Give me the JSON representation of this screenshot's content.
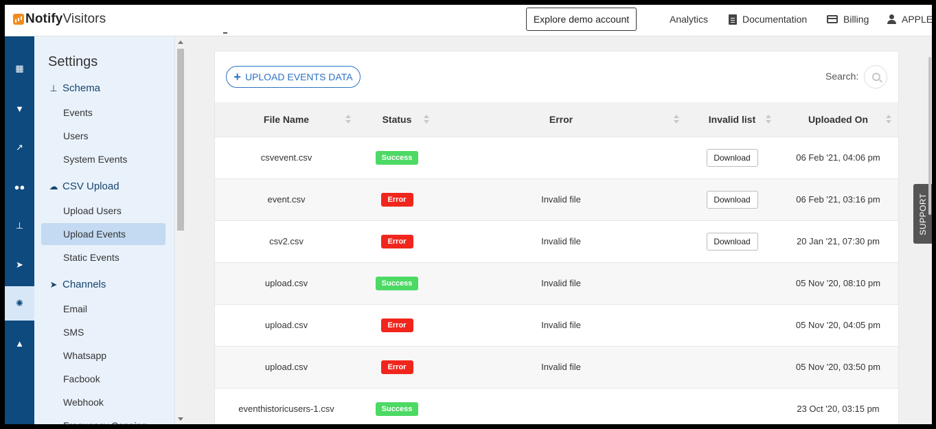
{
  "brand": {
    "name_bold": "Notify",
    "name_light": "Visitors"
  },
  "header": {
    "demo_button": "Explore demo account",
    "nav": [
      {
        "label": "Analytics",
        "icon": "grid-icon"
      },
      {
        "label": "Documentation",
        "icon": "document-icon"
      },
      {
        "label": "Billing",
        "icon": "credit-card-icon"
      },
      {
        "label": "APPLE",
        "icon": "user-icon"
      }
    ]
  },
  "rail": {
    "items": [
      {
        "icon": "dashboard-grid-icon",
        "glyph": "▦"
      },
      {
        "icon": "funnel-icon",
        "glyph": "▼"
      },
      {
        "icon": "line-chart-icon",
        "glyph": "↗"
      },
      {
        "icon": "users-icon",
        "glyph": "●●"
      },
      {
        "icon": "sitemap-icon",
        "glyph": "⊥"
      },
      {
        "icon": "send-icon",
        "glyph": "➤"
      },
      {
        "icon": "gear-icon",
        "glyph": "✺"
      },
      {
        "icon": "warning-icon",
        "glyph": "▲"
      }
    ]
  },
  "sidebar": {
    "title": "Settings",
    "groups": [
      {
        "label": "Schema",
        "icon": "sitemap-icon",
        "glyph": "⊥",
        "items": [
          "Events",
          "Users",
          "System Events"
        ]
      },
      {
        "label": "CSV Upload",
        "icon": "cloud-upload-icon",
        "glyph": "☁",
        "items": [
          "Upload Users",
          "Upload Events",
          "Static Events"
        ]
      },
      {
        "label": "Channels",
        "icon": "send-icon",
        "glyph": "➤",
        "items": [
          "Email",
          "SMS",
          "Whatsapp",
          "Facbook",
          "Webhook",
          "Frequency Capping"
        ]
      }
    ],
    "active_item": "Upload Events"
  },
  "toolbar": {
    "upload_label": "UPLOAD EVENTS DATA",
    "search_label": "Search:"
  },
  "table": {
    "columns": [
      "File Name",
      "Status",
      "Error",
      "Invalid list",
      "Uploaded On"
    ],
    "rows": [
      {
        "file": "csvevent.csv",
        "status": "Success",
        "error": "",
        "invalid": "Download",
        "uploaded": "06 Feb '21, 04:06 pm"
      },
      {
        "file": "event.csv",
        "status": "Error",
        "error": "Invalid file",
        "invalid": "Download",
        "uploaded": "06 Feb '21, 03:16 pm"
      },
      {
        "file": "csv2.csv",
        "status": "Error",
        "error": "Invalid file",
        "invalid": "Download",
        "uploaded": "20 Jan '21, 07:30 pm"
      },
      {
        "file": "upload.csv",
        "status": "Success",
        "error": "Invalid file",
        "invalid": "",
        "uploaded": "05 Nov '20, 08:10 pm"
      },
      {
        "file": "upload.csv",
        "status": "Error",
        "error": "Invalid file",
        "invalid": "",
        "uploaded": "05 Nov '20, 04:05 pm"
      },
      {
        "file": "upload.csv",
        "status": "Error",
        "error": "Invalid file",
        "invalid": "",
        "uploaded": "05 Nov '20, 03:50 pm"
      },
      {
        "file": "eventhistoricusers-1.csv",
        "status": "Success",
        "error": "",
        "invalid": "",
        "uploaded": "23 Oct '20, 03:15 pm"
      }
    ]
  },
  "support": {
    "label": "SUPPORT"
  },
  "colors": {
    "rail": "#0e4a7e",
    "accent": "#2a73c4",
    "success": "#4cd964",
    "error": "#f0261c"
  }
}
